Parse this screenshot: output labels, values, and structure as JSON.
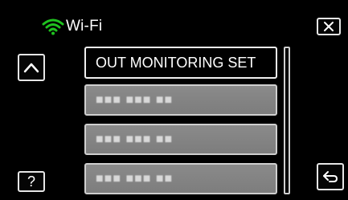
{
  "header": {
    "title": "Wi-Fi",
    "icon": "wifi-icon",
    "accent": "#1fc21f"
  },
  "controls": {
    "close": "close-icon",
    "up": "chevron-up-icon",
    "help_label": "?",
    "back": "back-arrow-icon"
  },
  "menu": {
    "items": [
      {
        "label": "OUT MONITORING SET",
        "selected": true
      },
      {
        "label": "■■■ ■■■ ■■"
      },
      {
        "label": "■■■ ■■■ ■■"
      },
      {
        "label": "■■■ ■■■ ■■"
      }
    ]
  }
}
